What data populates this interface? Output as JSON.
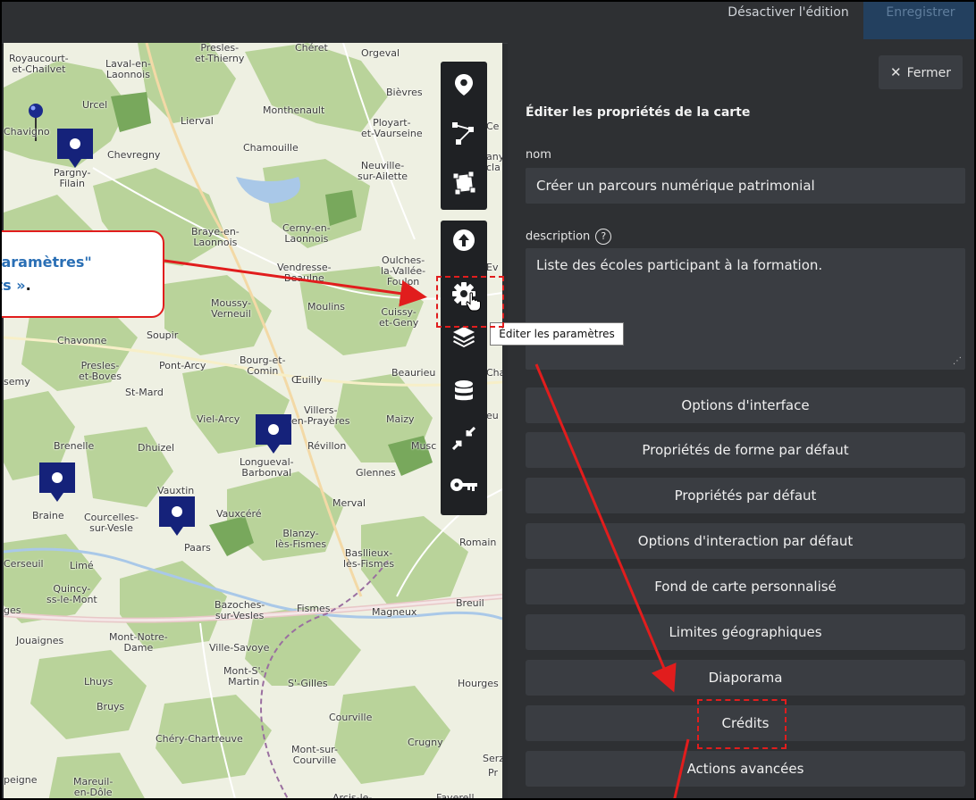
{
  "topbar": {
    "disable_label": "Désactiver l'édition",
    "save_label": "Enregistrer"
  },
  "map": {
    "places": [
      {
        "name": "Royaucourt-\net-Chailvet"
      },
      {
        "name": "Laval-en-\nLaonnois"
      },
      {
        "name": "Presles-\net-Thierny"
      },
      {
        "name": "Chéret"
      },
      {
        "name": "Orgeval"
      },
      {
        "name": "Bièvres"
      },
      {
        "name": "Urcel"
      },
      {
        "name": "Monthenault"
      },
      {
        "name": "Lierval"
      },
      {
        "name": "Ployart-\net-Vaurseine"
      },
      {
        "name": "Chavigno"
      },
      {
        "name": "Chamouille"
      },
      {
        "name": "Chevregny"
      },
      {
        "name": "Neuville-\nsur-Ailette"
      },
      {
        "name": "Pargny-\nFilain"
      },
      {
        "name": "Braye-en-\nLaonnois"
      },
      {
        "name": "Cerny-en-\nLaonnois"
      },
      {
        "name": "Vendresse-\nBeaulne"
      },
      {
        "name": "Oulches-\nla-Vallée-\nFoulon"
      },
      {
        "name": "Moussy-\nVerneuil"
      },
      {
        "name": "Moulins"
      },
      {
        "name": "Cuissy-\net-Geny"
      },
      {
        "name": "Chavonne"
      },
      {
        "name": "Soupir"
      },
      {
        "name": "Presles-\net-Boves"
      },
      {
        "name": "Pont-Arcy"
      },
      {
        "name": "Bourg-et-\nComin"
      },
      {
        "name": "Œuilly"
      },
      {
        "name": "Beaurieu"
      },
      {
        "name": "St-Mard"
      },
      {
        "name": "semy"
      },
      {
        "name": "Viel-Arcy"
      },
      {
        "name": "Villers-\nen-Prayères"
      },
      {
        "name": "Maizy"
      },
      {
        "name": "Brenelle"
      },
      {
        "name": "Dhuizel"
      },
      {
        "name": "Révillon"
      },
      {
        "name": "Musc"
      },
      {
        "name": "Longueval-\nBarbonval"
      },
      {
        "name": "Glennes"
      },
      {
        "name": "Vauxtin"
      },
      {
        "name": "Merval"
      },
      {
        "name": "Braine"
      },
      {
        "name": "Courcelles-\nsur-Vesle"
      },
      {
        "name": "Vauxcéré"
      },
      {
        "name": "Paars"
      },
      {
        "name": "Blanzy-\nlès-Fismes"
      },
      {
        "name": "Basllieux-\nlès-Fismes"
      },
      {
        "name": "Romain"
      },
      {
        "name": "Cerseuil"
      },
      {
        "name": "Limé"
      },
      {
        "name": "Quincy-\nss-le-Mont"
      },
      {
        "name": "Bazoches-\nsur-Vesles"
      },
      {
        "name": "Fismes"
      },
      {
        "name": "Magneux"
      },
      {
        "name": "Breuil"
      },
      {
        "name": "ges"
      },
      {
        "name": "Jouaignes"
      },
      {
        "name": "Mont-Notre-\nDame"
      },
      {
        "name": "Ville-Savoye"
      },
      {
        "name": "Mont-S'-\nMartin"
      },
      {
        "name": "S'-Gilles"
      },
      {
        "name": "Hourges"
      },
      {
        "name": "Lhuys"
      },
      {
        "name": "Bruys"
      },
      {
        "name": "Courville"
      },
      {
        "name": "Chéry-Chartreuve"
      },
      {
        "name": "Crugny"
      },
      {
        "name": "Mont-sur-\nCourville"
      },
      {
        "name": "Serz"
      },
      {
        "name": "Pr"
      },
      {
        "name": "peigne"
      },
      {
        "name": "Mareuil-\nen-Dôle"
      },
      {
        "name": "Arcis-le-"
      },
      {
        "name": "Faverell"
      },
      {
        "name": "cla"
      },
      {
        "name": "any"
      },
      {
        "name": "eu"
      },
      {
        "name": "Cha"
      },
      {
        "name": "Ce"
      },
      {
        "name": "Ev"
      }
    ]
  },
  "toolbar": {
    "tools": [
      {
        "icon": "marker-icon"
      },
      {
        "icon": "polyline-icon"
      },
      {
        "icon": "polygon-icon"
      },
      {
        "icon": "upload-icon"
      },
      {
        "icon": "gear-icon"
      },
      {
        "icon": "layers-icon"
      },
      {
        "icon": "database-icon"
      },
      {
        "icon": "shrink-arrows-icon"
      },
      {
        "icon": "key-icon"
      }
    ],
    "tooltip": "Éditer les paramètres"
  },
  "callout": {
    "line1": "paramètres\"",
    "line2": "its »",
    "line2_suffix": "."
  },
  "panel": {
    "close_label": "Fermer",
    "title": "Éditer les propriétés de la carte",
    "name_label": "nom",
    "name_value": "Créer un parcours numérique patrimonial",
    "description_label": "description",
    "help_glyph": "?",
    "description_value": "Liste des écoles participant à la formation.",
    "sections": [
      "Options d'interface",
      "Propriétés de forme par défaut",
      "Propriétés par défaut",
      "Options d'interaction par défaut",
      "Fond de carte personnalisé",
      "Limites géographiques",
      "Diaporama",
      "Crédits",
      "Actions avancées"
    ]
  },
  "colors": {
    "panel_bg": "#2e3033",
    "button_bg": "#3a3d42",
    "accent_red": "#e11d1d",
    "callout_text": "#2a6fb5",
    "marker": "#15227a"
  }
}
